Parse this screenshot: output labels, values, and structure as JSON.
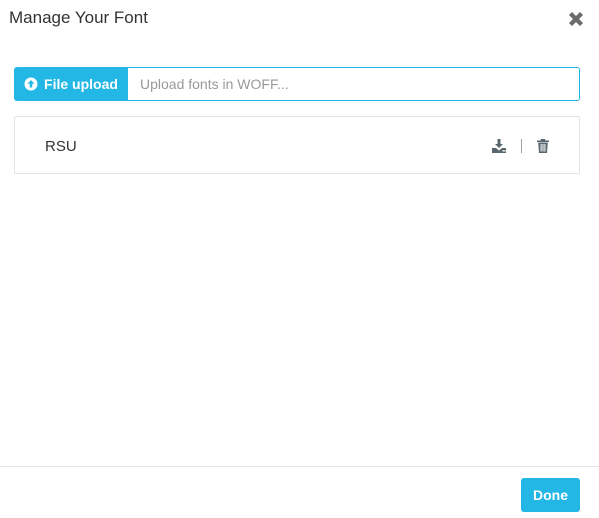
{
  "modal": {
    "title": "Manage Your Font",
    "close_icon": "close-icon"
  },
  "upload": {
    "button_label": "File upload",
    "button_icon": "upload-circle-icon",
    "placeholder": "Upload fonts in WOFF...",
    "value": ""
  },
  "fonts": [
    {
      "name": "RSU",
      "actions": [
        {
          "icon": "download-icon"
        },
        {
          "icon": "trash-icon"
        }
      ]
    }
  ],
  "footer": {
    "done_label": "Done"
  },
  "colors": {
    "accent": "#23b7e5",
    "text": "#333333",
    "placeholder": "#999999",
    "border": "#dee5e7",
    "icon": "#58666e"
  }
}
